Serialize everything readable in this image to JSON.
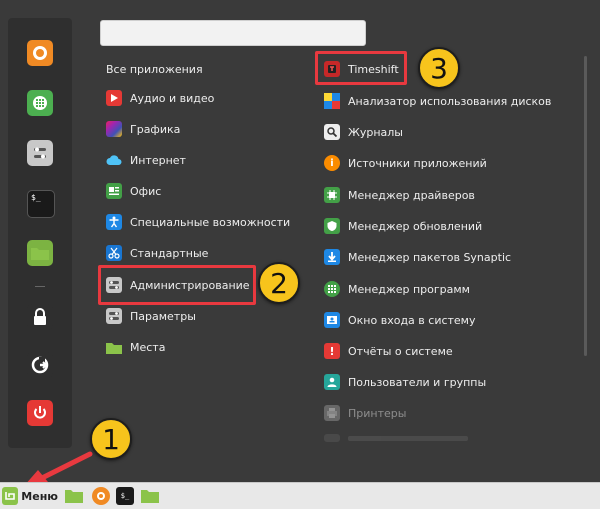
{
  "search": {
    "value": "",
    "placeholder": ""
  },
  "categories": [
    {
      "label": "Все приложения",
      "icon": "none"
    },
    {
      "label": "Аудио и видео",
      "icon": "play-icon"
    },
    {
      "label": "Графика",
      "icon": "graphics-icon"
    },
    {
      "label": "Интернет",
      "icon": "cloud-icon"
    },
    {
      "label": "Офис",
      "icon": "office-icon"
    },
    {
      "label": "Специальные возможности",
      "icon": "accessibility-icon"
    },
    {
      "label": "Стандартные",
      "icon": "scissors-icon"
    },
    {
      "label": "Администрирование",
      "icon": "admin-icon"
    },
    {
      "label": "Параметры",
      "icon": "settings-icon"
    },
    {
      "label": "Места",
      "icon": "folder-icon"
    }
  ],
  "apps": [
    {
      "label": "Timeshift",
      "icon": "timeshift-icon"
    },
    {
      "label": "Анализатор использования дисков",
      "icon": "disk-usage-icon"
    },
    {
      "label": "Журналы",
      "icon": "logs-icon"
    },
    {
      "label": "Источники приложений",
      "icon": "sources-icon"
    },
    {
      "label": "Менеджер драйверов",
      "icon": "driver-manager-icon"
    },
    {
      "label": "Менеджер обновлений",
      "icon": "update-manager-icon"
    },
    {
      "label": "Менеджер пакетов Synaptic",
      "icon": "synaptic-icon"
    },
    {
      "label": "Менеджер программ",
      "icon": "software-manager-icon"
    },
    {
      "label": "Окно входа в систему",
      "icon": "login-window-icon"
    },
    {
      "label": "Отчёты о системе",
      "icon": "system-reports-icon"
    },
    {
      "label": "Пользователи и группы",
      "icon": "users-groups-icon"
    },
    {
      "label": "Принтеры",
      "icon": "printers-icon"
    }
  ],
  "taskbar": {
    "menu_label": "Меню"
  },
  "annotations": {
    "badge1": "1",
    "badge2": "2",
    "badge3": "3"
  },
  "colors": {
    "highlight": "#e8393f",
    "badge": "#f7c41c",
    "panel": "#3a3a3a",
    "mint_green": "#8bc34a"
  }
}
